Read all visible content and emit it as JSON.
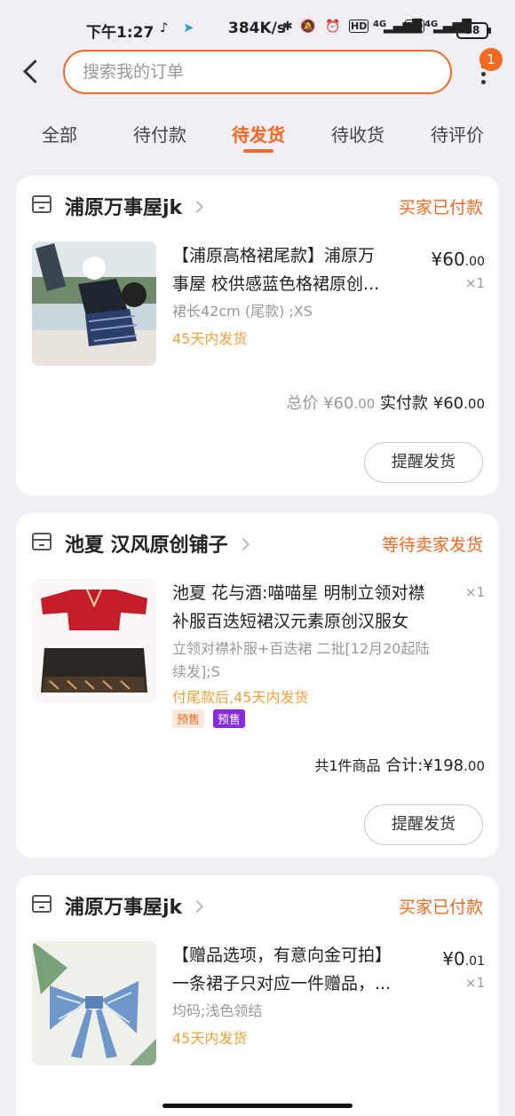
{
  "status_bar": {
    "time": "下午1:27",
    "network_speed": "384K/s",
    "battery": "58",
    "hd1": "HD",
    "net1": "4G",
    "hd2": "HD",
    "net2": "4G"
  },
  "search": {
    "placeholder": "搜索我的订单",
    "badge_count": "1"
  },
  "tabs": [
    {
      "label": "全部"
    },
    {
      "label": "待付款"
    },
    {
      "label": "待发货",
      "active": true
    },
    {
      "label": "待收货"
    },
    {
      "label": "待评价"
    }
  ],
  "orders": [
    {
      "store": "浦原万事屋jk",
      "status": "买家已付款",
      "title_line1": "【浦原高格裙尾款】浦原万",
      "title_line2": "事屋 校供感蓝色格裙原创...",
      "sku": "裙长42cm (尾款) ;XS",
      "shipping": "45天内发货",
      "price_int": "¥60",
      "price_dec": ".00",
      "qty": "×1",
      "total_label": "总价",
      "total_int": "¥60",
      "total_dec": ".00",
      "paid_label": "实付款",
      "paid_int": "¥60",
      "paid_dec": ".00",
      "button": "提醒发货"
    },
    {
      "store": "池夏 汉风原创铺子",
      "status": "等待卖家发货",
      "title_line1": "池夏 花与酒:喵喵星 明制立领对襟",
      "title_line2": "补服百迭短裙汉元素原创汉服女",
      "sku_line1": "立领对襟补服+百迭裙 二批[12月20起陆",
      "sku_line2": "续发];S",
      "shipping": "付尾款后,45天内发货",
      "tag1": "预售",
      "tag2": "预售",
      "qty": "×1",
      "count_text": "共1件商品",
      "total_label": "合计:",
      "total_int": "¥198",
      "total_dec": ".00",
      "button": "提醒发货"
    },
    {
      "store": "浦原万事屋jk",
      "status": "买家已付款",
      "title_line1": "【赠品选项，有意向金可拍】",
      "title_line2": "一条裙子只对应一件赠品，...",
      "sku": "均码;浅色领结",
      "shipping": "45天内发货",
      "price_int": "¥0",
      "price_dec": ".01",
      "qty": "×1"
    }
  ]
}
